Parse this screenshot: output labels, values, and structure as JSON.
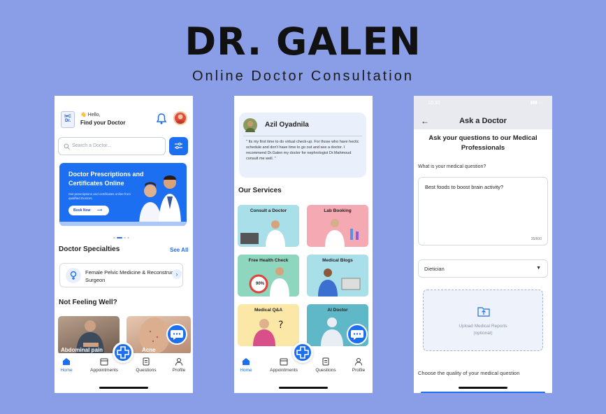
{
  "brand": {
    "title": "DR. GALEN",
    "tagline": "Online Doctor Consultation"
  },
  "screen1": {
    "greeting": "👋 Hello,",
    "title": "Find your Doctor",
    "search_placeholder": "Search a Doctor...",
    "banner": {
      "title": "Doctor Prescriptions and Certificates Online",
      "subtitle": "Get prescriptions and certificates online from qualified Doctors.",
      "button": "Book Now"
    },
    "specialties_title": "Doctor Specialties",
    "see_all": "See All",
    "specialty_item": "Female Pelvic Medicine & Reconstructive Surgeon",
    "not_feeling_title": "Not Feeling Well?",
    "cards": [
      "Abdominal pain",
      "Acne"
    ]
  },
  "screen2": {
    "reviewer": "Azil Oyadnila",
    "review": "\" Its my first time to do virtual check-up. For those who have hectic schedule and don't have time to go out and see a doctor. I recommend Dr.Galen my doctor for nephrologist Dr.Mahmoud consult me well. \"",
    "services_title": "Our Services",
    "services": [
      "Consult a Doctor",
      "Lab Booking",
      "Free Health Check",
      "Medical Blogs",
      "Medical Q&A",
      "AI Doctor"
    ],
    "health_percent": "90%"
  },
  "nav": {
    "home": "Home",
    "appointments": "Appointments",
    "questions": "Questions",
    "profile": "Profile"
  },
  "screen3": {
    "status_time": "10:30",
    "title": "Ask a Doctor",
    "heading": "Ask your questions to our Medical Professionals",
    "question_label": "What is your medical question?",
    "question_value": "Best foods to boost brain activity?",
    "char_count": "35/600",
    "specialty_value": "Dietician",
    "upload_label": "Upload Medical Reports",
    "upload_optional": "(optional)",
    "quality_label": "Choose the quality of your medical question"
  },
  "colors": {
    "background": "#8a9ee8",
    "primary": "#1e6ef0"
  }
}
